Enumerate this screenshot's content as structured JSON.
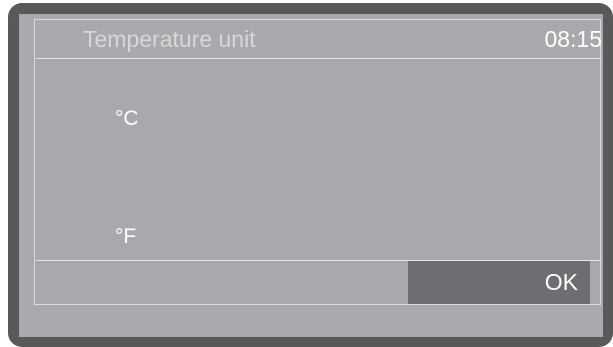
{
  "header": {
    "title": "Temperature unit",
    "time": "08:15"
  },
  "options": [
    {
      "label": "°C"
    },
    {
      "label": "°F"
    }
  ],
  "footer": {
    "ok_label": "OK"
  },
  "colors": {
    "bezel": "#58595b",
    "screen": "#a7a9ac",
    "button": "#6d6e71",
    "text": "#ffffff"
  }
}
